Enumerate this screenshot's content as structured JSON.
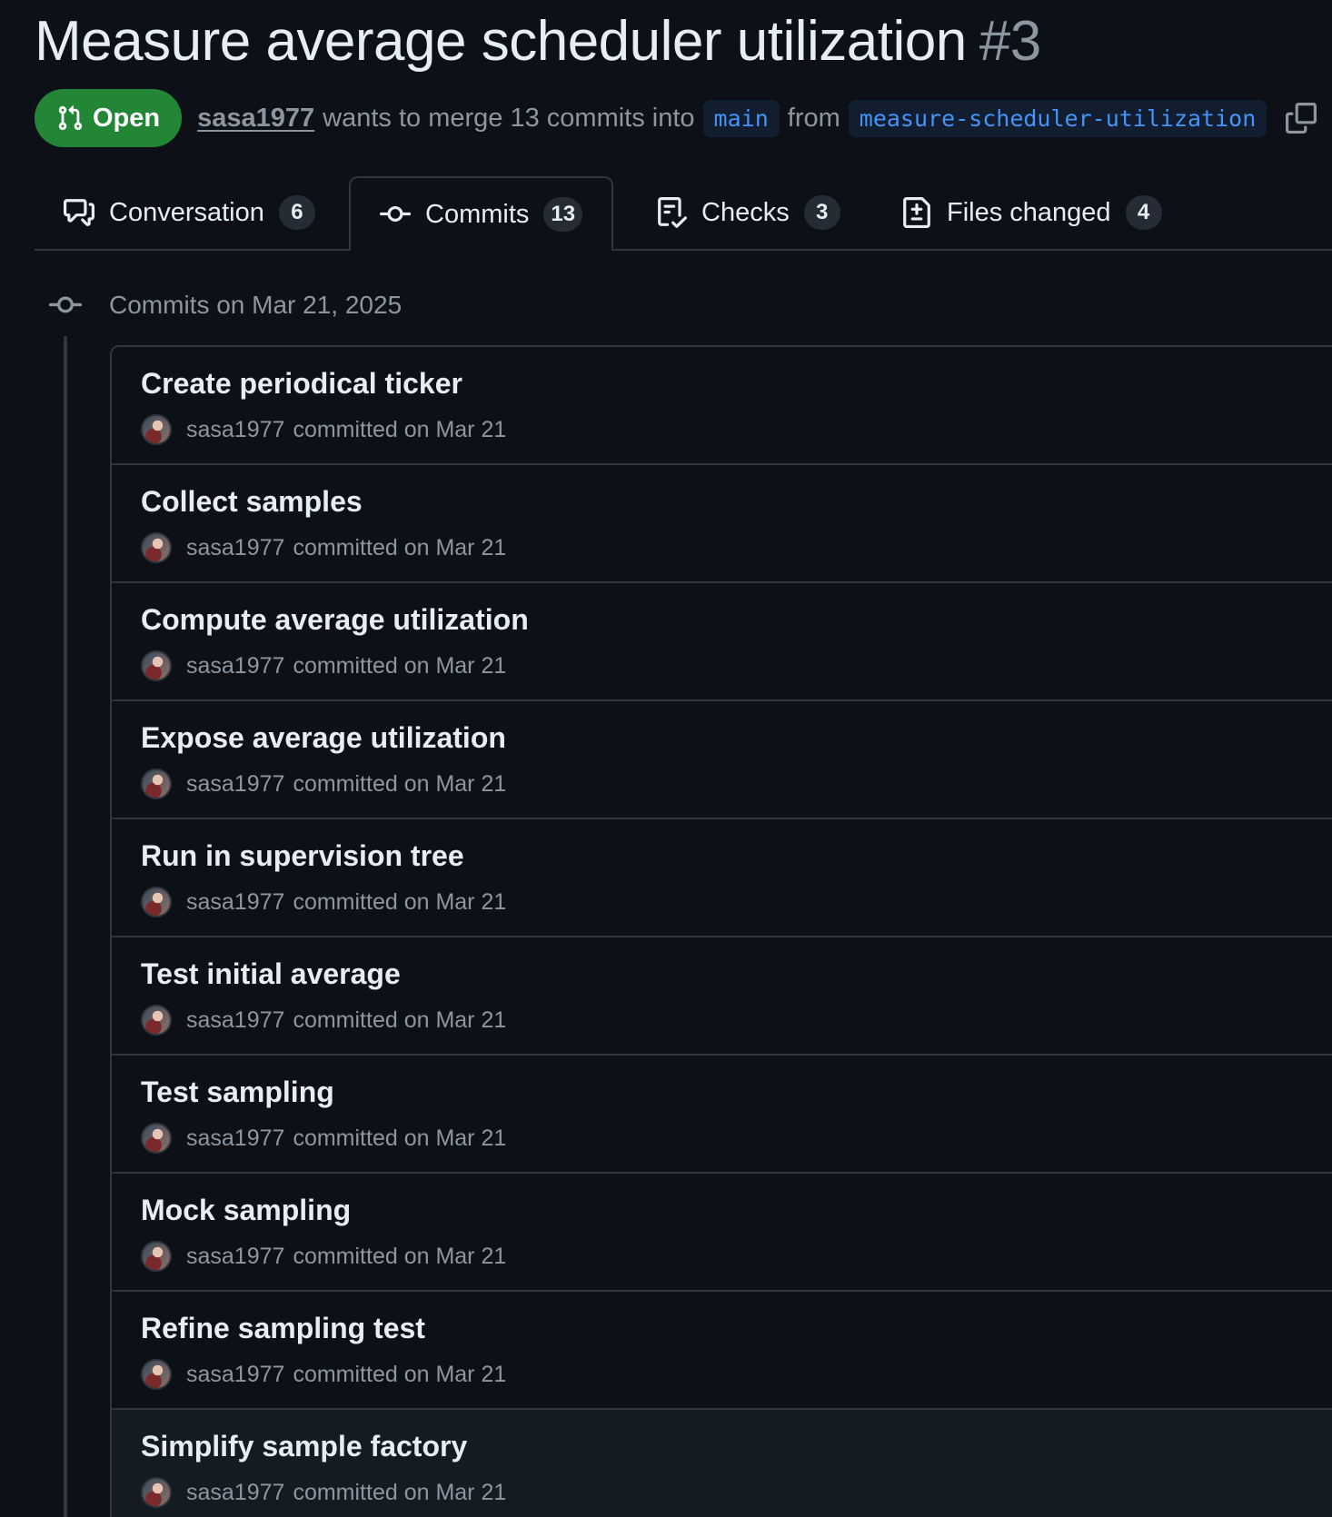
{
  "pr": {
    "title": "Measure average scheduler utilization",
    "number": "#3",
    "state": "Open",
    "author": "sasa1977",
    "merge_text": "wants to merge 13 commits into",
    "base_branch": "main",
    "from_text": "from",
    "head_branch": "measure-scheduler-utilization"
  },
  "tabs": [
    {
      "label": "Conversation",
      "count": "6",
      "icon": "comment-discussion-icon"
    },
    {
      "label": "Commits",
      "count": "13",
      "icon": "git-commit-icon",
      "selected": true
    },
    {
      "label": "Checks",
      "count": "3",
      "icon": "checklist-icon"
    },
    {
      "label": "Files changed",
      "count": "4",
      "icon": "file-diff-icon"
    }
  ],
  "commit_group": {
    "date_label": "Commits on Mar 21, 2025",
    "commits": [
      {
        "title": "Create periodical ticker",
        "author": "sasa1977",
        "action": "committed on Mar 21"
      },
      {
        "title": "Collect samples",
        "author": "sasa1977",
        "action": "committed on Mar 21"
      },
      {
        "title": "Compute average utilization",
        "author": "sasa1977",
        "action": "committed on Mar 21"
      },
      {
        "title": "Expose average utilization",
        "author": "sasa1977",
        "action": "committed on Mar 21"
      },
      {
        "title": "Run in supervision tree",
        "author": "sasa1977",
        "action": "committed on Mar 21"
      },
      {
        "title": "Test initial average",
        "author": "sasa1977",
        "action": "committed on Mar 21"
      },
      {
        "title": "Test sampling",
        "author": "sasa1977",
        "action": "committed on Mar 21"
      },
      {
        "title": "Mock sampling",
        "author": "sasa1977",
        "action": "committed on Mar 21"
      },
      {
        "title": "Refine sampling test",
        "author": "sasa1977",
        "action": "committed on Mar 21"
      },
      {
        "title": "Simplify sample factory",
        "author": "sasa1977",
        "action": "committed on Mar 21"
      }
    ]
  },
  "colors": {
    "background": "#0d1117",
    "open_badge": "#238636",
    "branch_text": "#4493f8",
    "muted_text": "#8d96a0",
    "border": "#30363d"
  }
}
